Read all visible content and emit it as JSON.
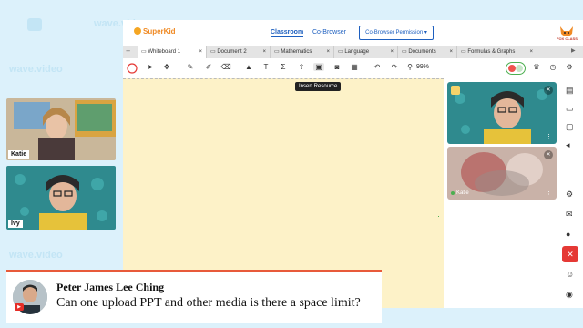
{
  "background": {
    "brand_watermark": "wave.video"
  },
  "left_cams": [
    {
      "name": "Katie"
    },
    {
      "name": "Ivy"
    }
  ],
  "app": {
    "logo": "SuperKid",
    "nav": {
      "classroom": "Classroom",
      "co_browser": "Co-Browser",
      "permission_button": "Co-Browser Permission",
      "permission_caret": "▾"
    },
    "brand_badge": "FOX CLASS",
    "tabs": [
      {
        "label": "Whiteboard 1",
        "active": true
      },
      {
        "label": "Document 2",
        "active": false
      },
      {
        "label": "Mathematics",
        "active": false
      },
      {
        "label": "Language",
        "active": false
      },
      {
        "label": "Documents",
        "active": false
      },
      {
        "label": "Formulas & Graphs",
        "active": false
      }
    ],
    "toolbar": {
      "zoom": "99%",
      "tooltip": "Insert Resource"
    },
    "right_cams": [
      {
        "name": "",
        "mic_state": "muted"
      },
      {
        "name": "Katie",
        "mic_state": "muted"
      }
    ],
    "colors": {
      "canvas": "#fdf2c8",
      "accent": "#1d5fbf",
      "brand": "#f08a24"
    }
  },
  "caption": {
    "name": "Peter James Lee Ching",
    "text": "Can one upload PPT and other media is there a space limit?"
  }
}
